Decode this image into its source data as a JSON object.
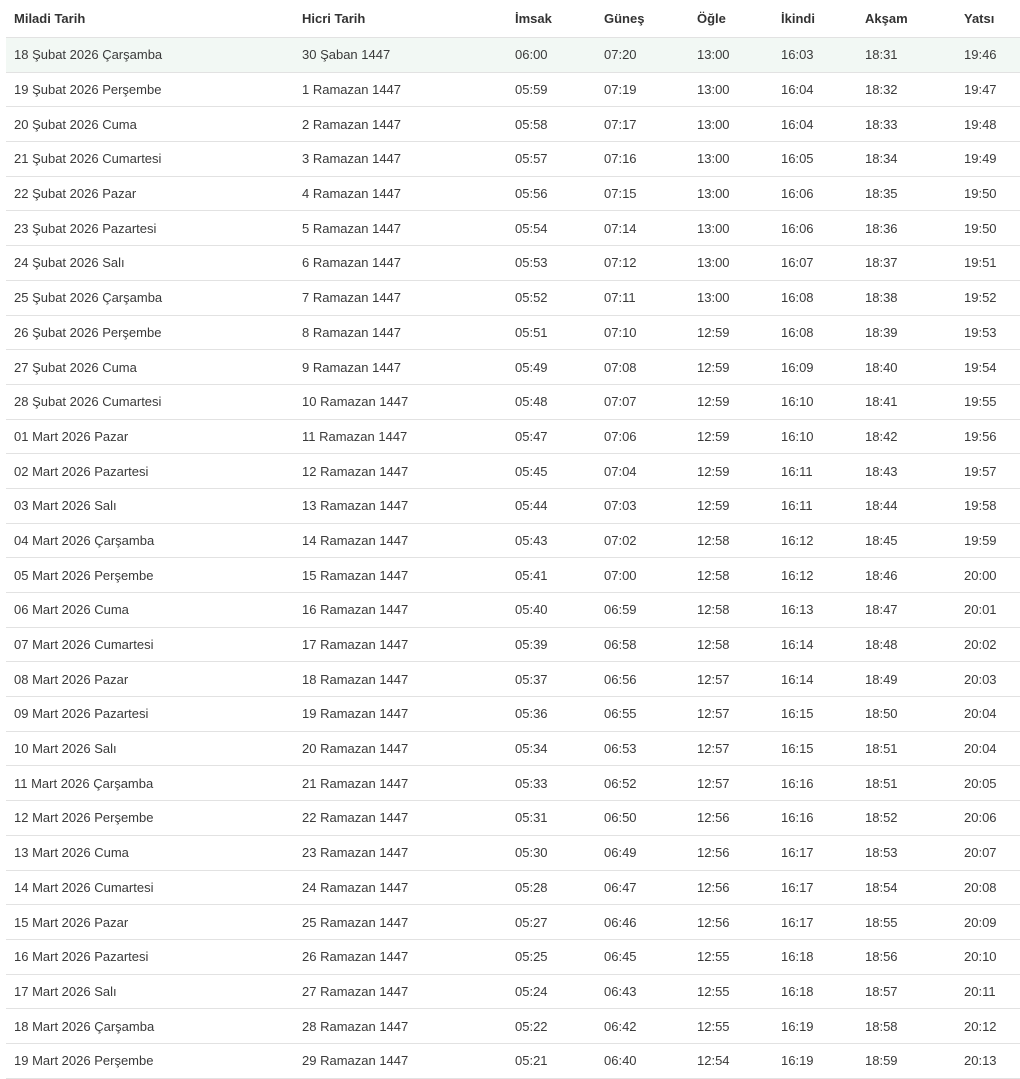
{
  "table": {
    "headers": [
      "Miladi Tarih",
      "Hicri Tarih",
      "İmsak",
      "Güneş",
      "Öğle",
      "İkindi",
      "Akşam",
      "Yatsı"
    ],
    "rows": [
      [
        "18 Şubat 2026 Çarşamba",
        "30 Şaban 1447",
        "06:00",
        "07:20",
        "13:00",
        "16:03",
        "18:31",
        "19:46"
      ],
      [
        "19 Şubat 2026 Perşembe",
        "1 Ramazan 1447",
        "05:59",
        "07:19",
        "13:00",
        "16:04",
        "18:32",
        "19:47"
      ],
      [
        "20 Şubat 2026 Cuma",
        "2 Ramazan 1447",
        "05:58",
        "07:17",
        "13:00",
        "16:04",
        "18:33",
        "19:48"
      ],
      [
        "21 Şubat 2026 Cumartesi",
        "3 Ramazan 1447",
        "05:57",
        "07:16",
        "13:00",
        "16:05",
        "18:34",
        "19:49"
      ],
      [
        "22 Şubat 2026 Pazar",
        "4 Ramazan 1447",
        "05:56",
        "07:15",
        "13:00",
        "16:06",
        "18:35",
        "19:50"
      ],
      [
        "23 Şubat 2026 Pazartesi",
        "5 Ramazan 1447",
        "05:54",
        "07:14",
        "13:00",
        "16:06",
        "18:36",
        "19:50"
      ],
      [
        "24 Şubat 2026 Salı",
        "6 Ramazan 1447",
        "05:53",
        "07:12",
        "13:00",
        "16:07",
        "18:37",
        "19:51"
      ],
      [
        "25 Şubat 2026 Çarşamba",
        "7 Ramazan 1447",
        "05:52",
        "07:11",
        "13:00",
        "16:08",
        "18:38",
        "19:52"
      ],
      [
        "26 Şubat 2026 Perşembe",
        "8 Ramazan 1447",
        "05:51",
        "07:10",
        "12:59",
        "16:08",
        "18:39",
        "19:53"
      ],
      [
        "27 Şubat 2026 Cuma",
        "9 Ramazan 1447",
        "05:49",
        "07:08",
        "12:59",
        "16:09",
        "18:40",
        "19:54"
      ],
      [
        "28 Şubat 2026 Cumartesi",
        "10 Ramazan 1447",
        "05:48",
        "07:07",
        "12:59",
        "16:10",
        "18:41",
        "19:55"
      ],
      [
        "01 Mart 2026 Pazar",
        "11 Ramazan 1447",
        "05:47",
        "07:06",
        "12:59",
        "16:10",
        "18:42",
        "19:56"
      ],
      [
        "02 Mart 2026 Pazartesi",
        "12 Ramazan 1447",
        "05:45",
        "07:04",
        "12:59",
        "16:11",
        "18:43",
        "19:57"
      ],
      [
        "03 Mart 2026 Salı",
        "13 Ramazan 1447",
        "05:44",
        "07:03",
        "12:59",
        "16:11",
        "18:44",
        "19:58"
      ],
      [
        "04 Mart 2026 Çarşamba",
        "14 Ramazan 1447",
        "05:43",
        "07:02",
        "12:58",
        "16:12",
        "18:45",
        "19:59"
      ],
      [
        "05 Mart 2026 Perşembe",
        "15 Ramazan 1447",
        "05:41",
        "07:00",
        "12:58",
        "16:12",
        "18:46",
        "20:00"
      ],
      [
        "06 Mart 2026 Cuma",
        "16 Ramazan 1447",
        "05:40",
        "06:59",
        "12:58",
        "16:13",
        "18:47",
        "20:01"
      ],
      [
        "07 Mart 2026 Cumartesi",
        "17 Ramazan 1447",
        "05:39",
        "06:58",
        "12:58",
        "16:14",
        "18:48",
        "20:02"
      ],
      [
        "08 Mart 2026 Pazar",
        "18 Ramazan 1447",
        "05:37",
        "06:56",
        "12:57",
        "16:14",
        "18:49",
        "20:03"
      ],
      [
        "09 Mart 2026 Pazartesi",
        "19 Ramazan 1447",
        "05:36",
        "06:55",
        "12:57",
        "16:15",
        "18:50",
        "20:04"
      ],
      [
        "10 Mart 2026 Salı",
        "20 Ramazan 1447",
        "05:34",
        "06:53",
        "12:57",
        "16:15",
        "18:51",
        "20:04"
      ],
      [
        "11 Mart 2026 Çarşamba",
        "21 Ramazan 1447",
        "05:33",
        "06:52",
        "12:57",
        "16:16",
        "18:51",
        "20:05"
      ],
      [
        "12 Mart 2026 Perşembe",
        "22 Ramazan 1447",
        "05:31",
        "06:50",
        "12:56",
        "16:16",
        "18:52",
        "20:06"
      ],
      [
        "13 Mart 2026 Cuma",
        "23 Ramazan 1447",
        "05:30",
        "06:49",
        "12:56",
        "16:17",
        "18:53",
        "20:07"
      ],
      [
        "14 Mart 2026 Cumartesi",
        "24 Ramazan 1447",
        "05:28",
        "06:47",
        "12:56",
        "16:17",
        "18:54",
        "20:08"
      ],
      [
        "15 Mart 2026 Pazar",
        "25 Ramazan 1447",
        "05:27",
        "06:46",
        "12:56",
        "16:17",
        "18:55",
        "20:09"
      ],
      [
        "16 Mart 2026 Pazartesi",
        "26 Ramazan 1447",
        "05:25",
        "06:45",
        "12:55",
        "16:18",
        "18:56",
        "20:10"
      ],
      [
        "17 Mart 2026 Salı",
        "27 Ramazan 1447",
        "05:24",
        "06:43",
        "12:55",
        "16:18",
        "18:57",
        "20:11"
      ],
      [
        "18 Mart 2026 Çarşamba",
        "28 Ramazan 1447",
        "05:22",
        "06:42",
        "12:55",
        "16:19",
        "18:58",
        "20:12"
      ],
      [
        "19 Mart 2026 Perşembe",
        "29 Ramazan 1447",
        "05:21",
        "06:40",
        "12:54",
        "16:19",
        "18:59",
        "20:13"
      ]
    ],
    "highlighted_row_index": 0,
    "highlight_color": "#f2f8f4",
    "border_color": "#e2e2e2"
  }
}
